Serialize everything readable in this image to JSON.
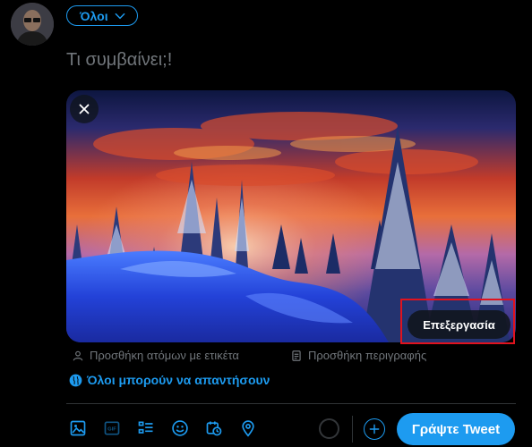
{
  "header": {
    "audience_label": "Όλοι"
  },
  "compose": {
    "placeholder": "Τι συμβαίνει;!"
  },
  "media": {
    "edit_label": "Επεξεργασία"
  },
  "media_actions": {
    "tag_people": "Προσθήκη ατόμων με ετικέτα",
    "add_description": "Προσθήκη περιγραφής"
  },
  "reply_setting": {
    "label": "Όλοι μπορούν να απαντήσουν"
  },
  "toolbar": {
    "icons": [
      "image-icon",
      "gif-icon",
      "poll-icon",
      "emoji-icon",
      "schedule-icon",
      "location-icon"
    ],
    "gif_text": "GIF"
  },
  "actions": {
    "tweet_label": "Γράψτε Tweet"
  },
  "colors": {
    "accent": "#1d9bf0",
    "highlight": "#e0131e",
    "muted": "#71767b"
  }
}
